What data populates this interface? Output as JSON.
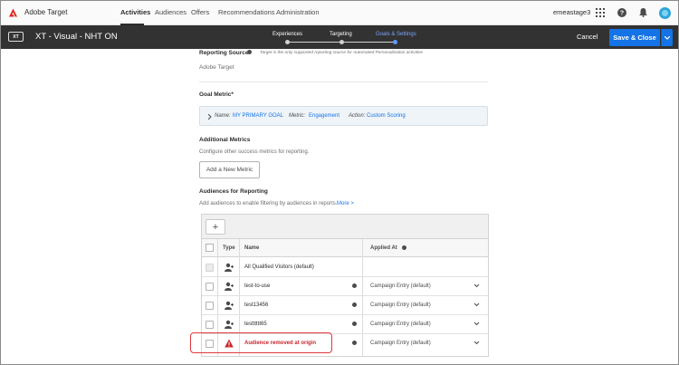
{
  "topnav": {
    "app_name": "Adobe Target",
    "items": [
      {
        "label": "Activities",
        "active": true
      },
      {
        "label": "Audiences"
      },
      {
        "label": "Offers"
      },
      {
        "label": "Recommendations"
      },
      {
        "label": "Administration"
      }
    ],
    "user": "emeastage3",
    "icons": [
      "apps-grid-icon",
      "help-icon",
      "notifications-bell-icon",
      "avatar"
    ]
  },
  "header": {
    "badge": "XT",
    "title": "XT - Visual - NHT ON",
    "steps": [
      {
        "label": "Experiences"
      },
      {
        "label": "Targeting"
      },
      {
        "label": "Goals & Settings",
        "active": true
      }
    ],
    "cancel_label": "Cancel",
    "save_label": "Save & Close"
  },
  "reporting_source": {
    "title": "Reporting Source",
    "note": "Target is the only supported reporting source for Automated Personalization activities",
    "value": "Adobe Target"
  },
  "goal_metric": {
    "title": "Goal Metric*",
    "name_label": "Name:",
    "name_value": "MY PRIMARY GOAL",
    "metric_label": "Metric:",
    "metric_value": "Engagement",
    "action_label": "Action:",
    "action_value": "Custom Scoring"
  },
  "additional_metrics": {
    "title": "Additional Metrics",
    "description": "Configure other success metrics for reporting.",
    "button": "Add a New Metric"
  },
  "audiences": {
    "title": "Audiences for Reporting",
    "description": "Add audiences to enable filtering by audiences in reports.",
    "more_link": "More >",
    "add_button": "+",
    "columns": {
      "type": "Type",
      "name": "Name",
      "applied_at": "Applied At"
    },
    "rows": [
      {
        "name": "All Qualified Visitors (default)",
        "applied": "",
        "icon": "audience-icon",
        "disabled": true
      },
      {
        "name": "test-to-use",
        "applied": "Campaign Entry (default)",
        "icon": "audience-icon"
      },
      {
        "name": "test13456",
        "applied": "Campaign Entry (default)",
        "icon": "audience-icon"
      },
      {
        "name": "testttttt65",
        "applied": "Campaign Entry (default)",
        "icon": "audience-icon"
      },
      {
        "name": "Audience removed at origin",
        "applied": "Campaign Entry (default)",
        "icon": "warning-icon",
        "error": true
      }
    ]
  },
  "colors": {
    "accent": "#1473e6",
    "error": "#c9252d",
    "dark_bar": "#323232"
  }
}
